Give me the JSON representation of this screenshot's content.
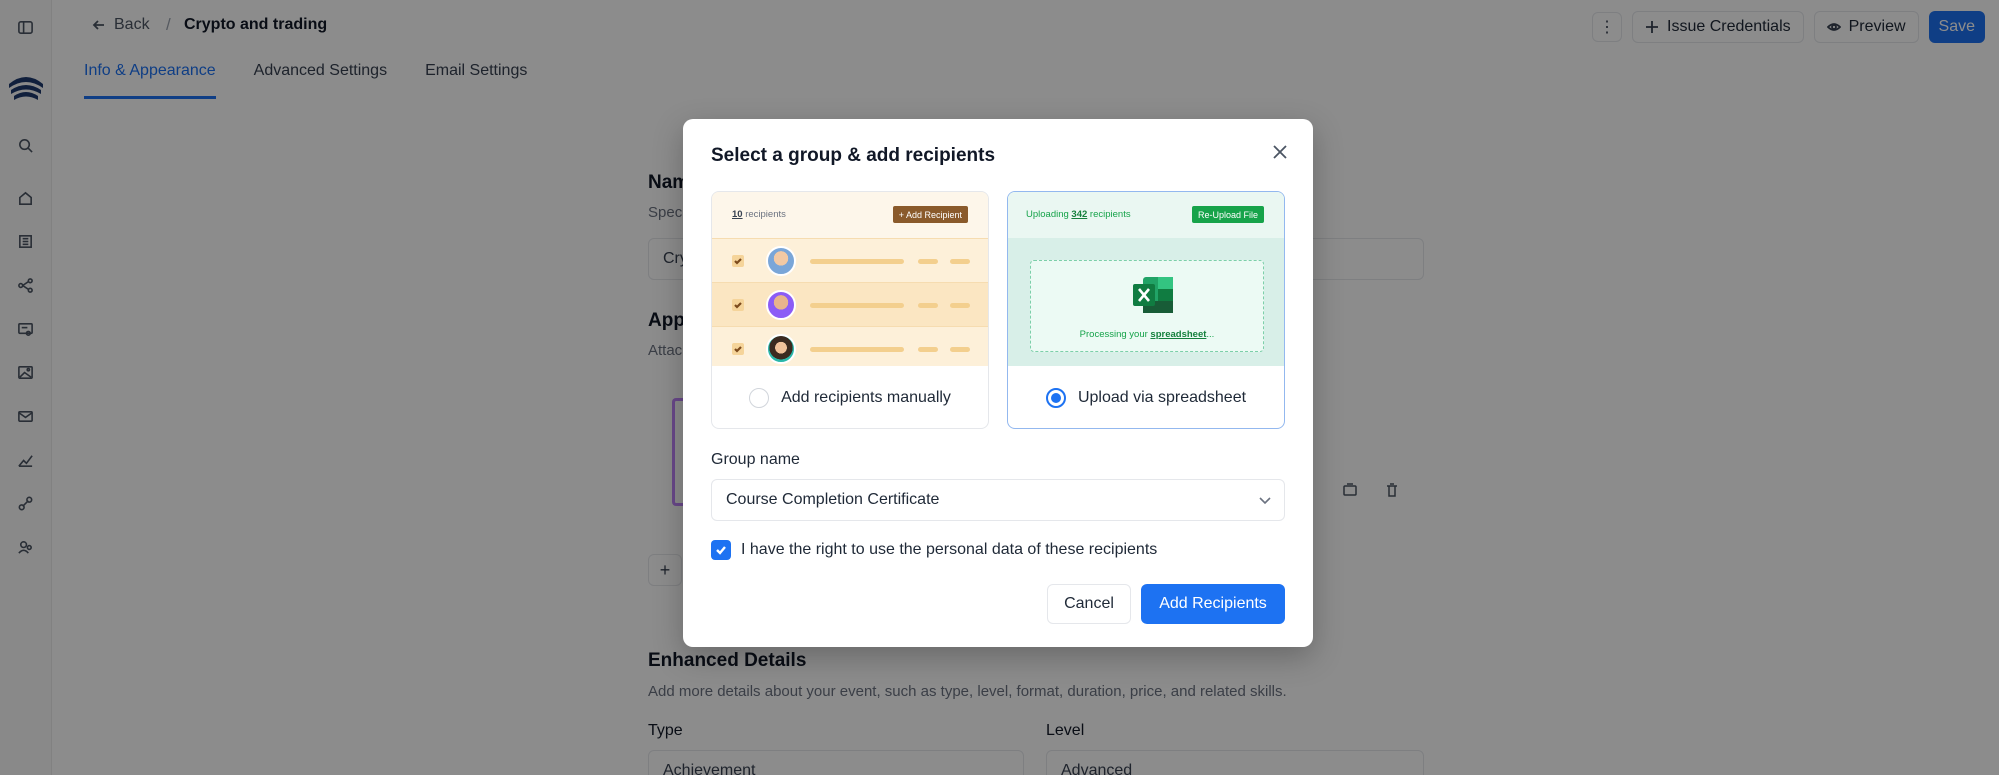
{
  "header": {
    "back_label": "Back",
    "breadcrumb_separator": "/",
    "title": "Crypto and trading",
    "more_label": "⋮",
    "issue_label": "Issue Credentials",
    "preview_label": "Preview",
    "save_label": "Save"
  },
  "sidebar": {
    "icons": [
      "sidebar-toggle-icon",
      "logo",
      "search-icon",
      "home-icon",
      "building-icon",
      "workflow-icon",
      "certificate-icon",
      "image-icon",
      "mail-icon",
      "analytics-icon",
      "integrations-icon",
      "users-icon"
    ]
  },
  "tabs": [
    {
      "label": "Info & Appearance",
      "active": true
    },
    {
      "label": "Advanced Settings",
      "active": false
    },
    {
      "label": "Email Settings",
      "active": false
    }
  ],
  "background": {
    "name_heading_partial": "Nam",
    "name_sub_partial": "Spec",
    "name_input_partial": "Cry",
    "appearance_heading_partial": "App",
    "appearance_sub_partial": "Attac",
    "add_partial": "+",
    "enhanced_heading": "Enhanced Details",
    "enhanced_sub": "Add more details about your event, such as type, level, format, duration, price, and related skills.",
    "type_label": "Type",
    "type_value": "Achievement",
    "level_label": "Level",
    "level_value": "Advanced"
  },
  "modal": {
    "title": "Select a group & add recipients",
    "option_manual": {
      "label": "Add recipients manually",
      "selected": false,
      "preview": {
        "count_number": "10",
        "count_text": " recipients",
        "add_button": "+ Add Recipient"
      }
    },
    "option_sheet": {
      "label": "Upload via spreadsheet",
      "selected": true,
      "preview": {
        "uploading_prefix": "Uploading ",
        "count_number": "342",
        "count_suffix": " recipients",
        "reupload_button": "Re-Upload File",
        "processing_prefix": "Processing your ",
        "processing_link": "spreadsheet",
        "processing_suffix": "..."
      }
    },
    "group_name_label": "Group name",
    "group_name_value": "Course Completion Certificate",
    "consent_label": "I have the right to use the personal data of these recipients",
    "consent_checked": true,
    "cancel_label": "Cancel",
    "add_label": "Add Recipients"
  },
  "colors": {
    "accent": "#1d72f2",
    "manual_preview": "#fdf0d9",
    "sheet_preview": "#d8efe8",
    "excel_green": "#16a34a"
  }
}
